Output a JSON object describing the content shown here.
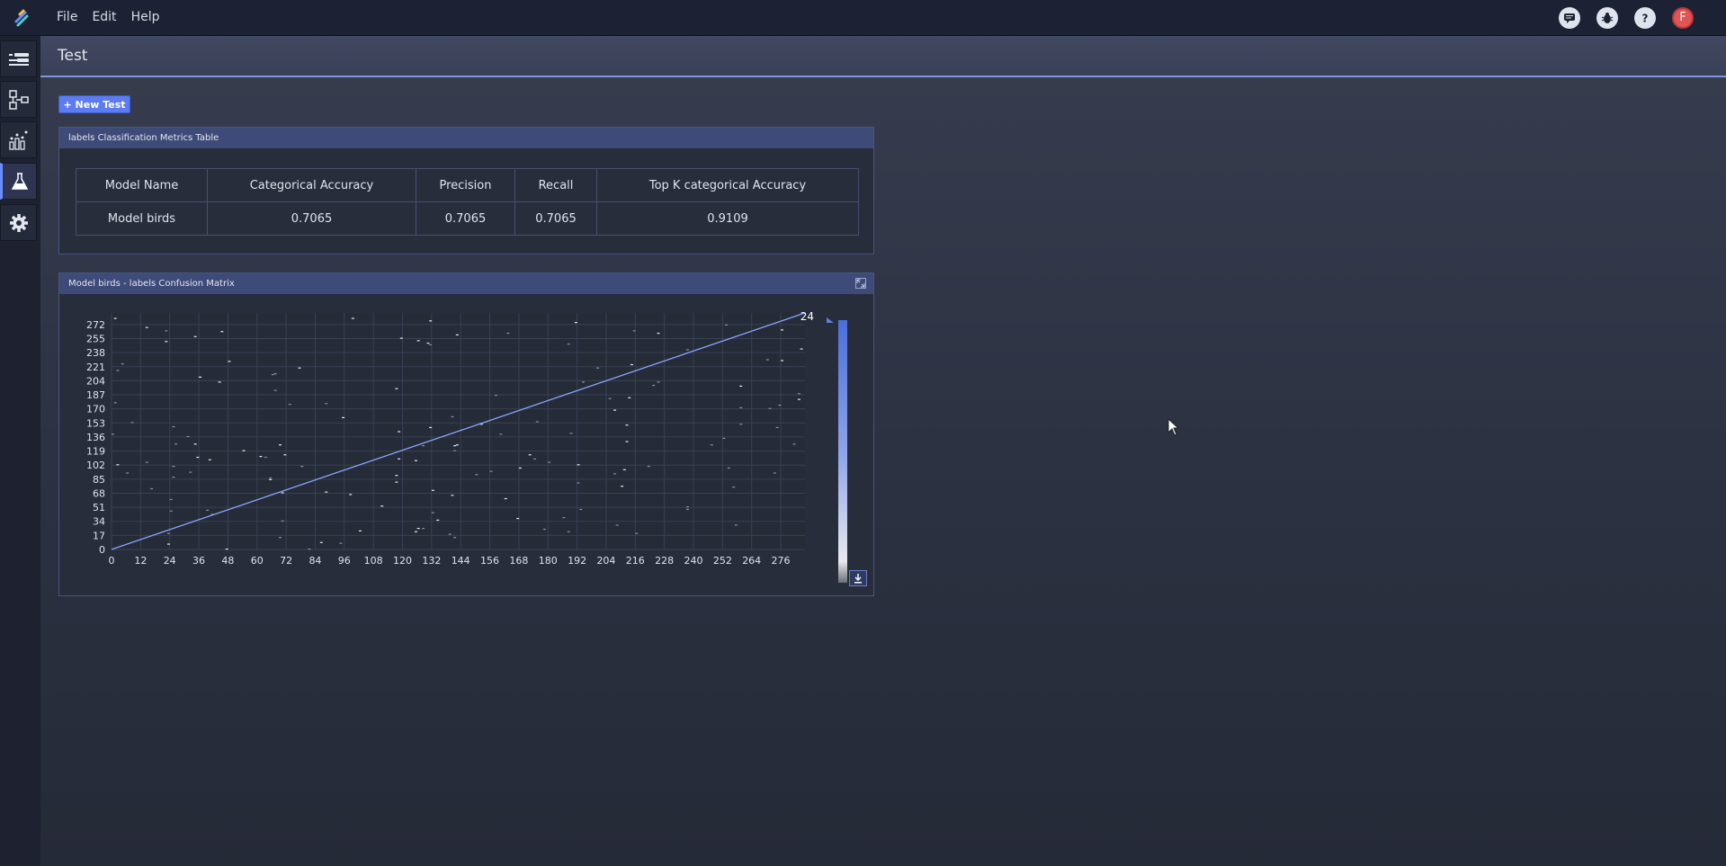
{
  "menu": {
    "file": "File",
    "edit": "Edit",
    "help": "Help"
  },
  "top_icons": [
    "chat-icon",
    "bug-icon",
    "help-icon"
  ],
  "avatar": {
    "initial": "F"
  },
  "sidebar": {
    "items": [
      {
        "icon": "layers-icon",
        "active": false
      },
      {
        "icon": "network-icon",
        "active": false
      },
      {
        "icon": "training-icon",
        "active": false
      },
      {
        "icon": "flask-icon",
        "active": true
      },
      {
        "icon": "gear-icon",
        "active": false
      }
    ]
  },
  "page": {
    "title": "Test"
  },
  "toolbar": {
    "new_test_label": "+ New Test"
  },
  "metrics_panel": {
    "title": "labels Classification Metrics Table",
    "columns": [
      "Model Name",
      "Categorical Accuracy",
      "Precision",
      "Recall",
      "Top K categorical Accuracy"
    ],
    "rows": [
      [
        "Model birds",
        "0.7065",
        "0.7065",
        "0.7065",
        "0.9109"
      ]
    ]
  },
  "confusion_panel": {
    "title": "Model birds - labels Confusion Matrix"
  },
  "chart_data": {
    "type": "heatmap",
    "title": "",
    "xlabel": "",
    "ylabel": "",
    "x_ticks": [
      0,
      12,
      24,
      36,
      48,
      60,
      72,
      84,
      96,
      108,
      120,
      132,
      144,
      156,
      168,
      180,
      192,
      204,
      216,
      228,
      240,
      252,
      264,
      276
    ],
    "y_ticks": [
      0,
      17,
      34,
      51,
      68,
      85,
      102,
      119,
      136,
      153,
      170,
      187,
      204,
      221,
      238,
      255,
      272
    ],
    "xlim": [
      0,
      286
    ],
    "ylim": [
      0,
      286
    ],
    "grid": true,
    "colorbar": {
      "max_label": "24",
      "min": 0,
      "max": 24,
      "colors": [
        "#e8e8ee",
        "#4a6fdc"
      ]
    },
    "diagonal_value": 24,
    "background": "#262b38"
  },
  "colors": {
    "accent": "#5c7cf0",
    "header_border": "#7f97d8",
    "panel_head": "#3e4a77"
  }
}
